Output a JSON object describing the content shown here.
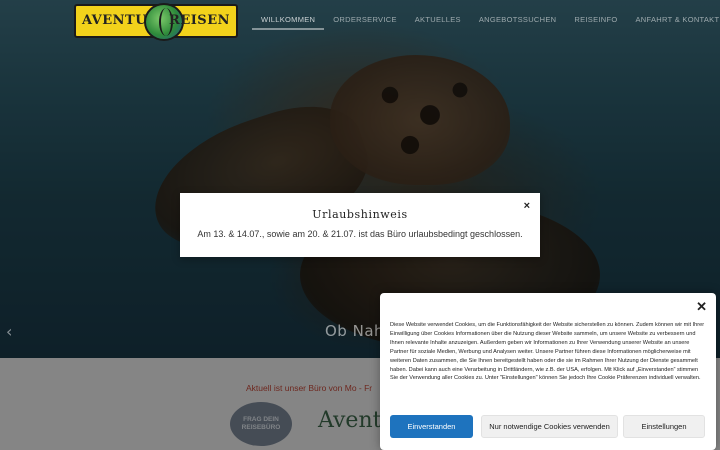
{
  "brand": {
    "logo_left": "AVENTURA",
    "logo_right": "REISEN"
  },
  "nav": {
    "items": [
      {
        "label": "WILLKOMMEN",
        "active": true
      },
      {
        "label": "ORDERSERVICE",
        "active": false
      },
      {
        "label": "AKTUELLES",
        "active": false
      },
      {
        "label": "ANGEBOTSSUCHEN",
        "active": false
      },
      {
        "label": "REISEINFO",
        "active": false
      },
      {
        "label": "ANFAHRT & KONTAKT",
        "active": false
      }
    ]
  },
  "slider": {
    "prev_arrow": "‹",
    "slide_text": "Ob Nah"
  },
  "notice": {
    "current": "Aktuell ist unser Büro von Mo - Fr",
    "badge_lines": [
      "FRAG DEIN",
      "REISEBÜRO"
    ],
    "aventura": "Aventu"
  },
  "modal": {
    "title": "Urlaubshinweis",
    "body": "Am 13. & 14.07., sowie am 20. & 21.07. ist das Büro urlaubsbedingt geschlossen.",
    "close": "×"
  },
  "cookie": {
    "close": "✕",
    "text": "Diese Website verwendet Cookies, um die Funktionsfähigkeit der Website sicherstellen zu können. Zudem können wir mit Ihrer Einwilligung über Cookies Informationen über die Nutzung dieser Website sammeln, um unsere Website zu verbessern und Ihnen relevante Inhalte anzuzeigen. Außerdem geben wir Informationen zu Ihrer Verwendung unserer Website an unsere Partner für soziale Medien, Werbung und Analysen weiter. Unsere Partner führen diese Informationen möglicherweise mit weiteren Daten zusammen, die Sie Ihnen bereitgestellt haben oder die sie im Rahmen Ihrer Nutzung der Dienste gesammelt haben. Dabei kann auch eine Verarbeitung in Drittländern, wie z.B. der USA, erfolgen. Mit Klick auf „Einverstanden“ stimmen Sie der Verwendung aller Cookies zu. Unter \"Einstellungen\" können Sie jedoch Ihre Cookie Präferenzen individuell verwalten.",
    "accept": "Einverstanden",
    "necessary": "Nur notwendige Cookies verwenden",
    "settings": "Einstellungen"
  },
  "colors": {
    "accent_blue": "#1e73be",
    "logo_yellow": "#f2d21b",
    "notice_red": "#c84a3a"
  }
}
